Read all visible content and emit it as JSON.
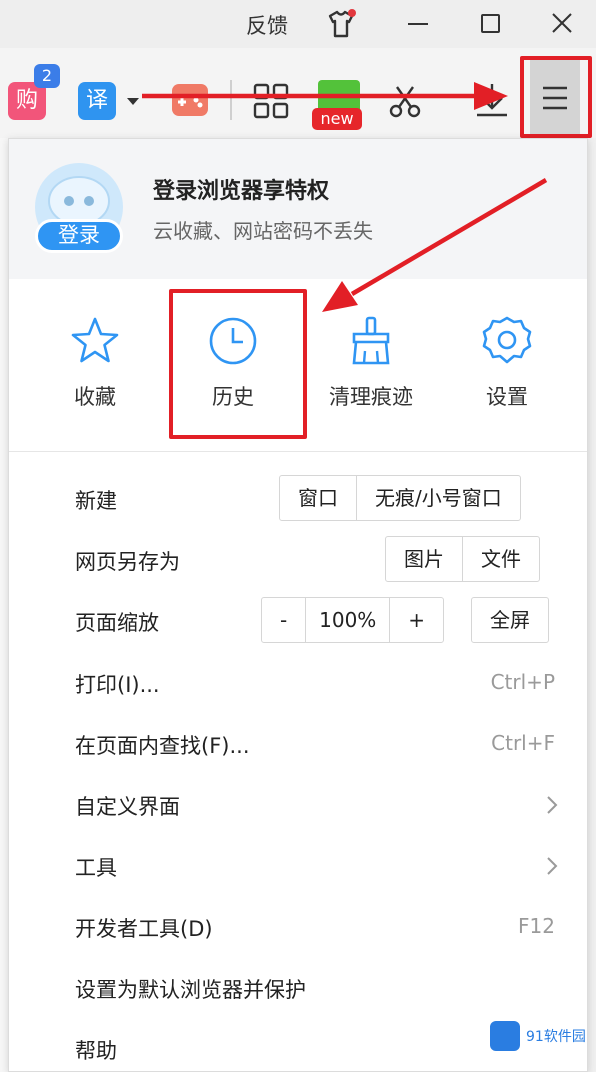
{
  "titlebar": {
    "feedback": "反馈",
    "icons": [
      "shirt-icon",
      "minimize-icon",
      "maximize-icon",
      "close-icon"
    ],
    "notify_color": "#e2373d"
  },
  "toolbar": {
    "buy_glyph": "购",
    "buy_badge": "2",
    "translate_glyph": "译",
    "new_badge": "new",
    "icons": [
      "shop-icon",
      "translate-icon",
      "dropdown-arrow-icon",
      "game-icon",
      "apps-grid-icon",
      "green-app-icon",
      "scissors-icon",
      "download-icon",
      "menu-icon"
    ]
  },
  "login": {
    "badge": "登录",
    "title": "登录浏览器享特权",
    "subtitle": "云收藏、网站密码不丢失"
  },
  "quick_actions": [
    {
      "label": "收藏",
      "icon": "star-icon"
    },
    {
      "label": "历史",
      "icon": "clock-icon"
    },
    {
      "label": "清理痕迹",
      "icon": "broom-icon"
    },
    {
      "label": "设置",
      "icon": "gear-icon"
    }
  ],
  "menu": {
    "new": {
      "label": "新建",
      "window": "窗口",
      "incognito": "无痕/小号窗口"
    },
    "save_as": {
      "label": "网页另存为",
      "image": "图片",
      "file": "文件"
    },
    "zoom": {
      "label": "页面缩放",
      "minus": "-",
      "value": "100%",
      "plus": "+",
      "fullscreen": "全屏"
    },
    "print": {
      "label": "打印(I)...",
      "shortcut": "Ctrl+P"
    },
    "find": {
      "label": "在页面内查找(F)...",
      "shortcut": "Ctrl+F"
    },
    "customize": {
      "label": "自定义界面"
    },
    "tools": {
      "label": "工具"
    },
    "devtools": {
      "label": "开发者工具(D)",
      "shortcut": "F12"
    },
    "default_browser": {
      "label": "设置为默认浏览器并保护"
    },
    "help": {
      "label": "帮助"
    }
  },
  "watermark": "91软件园",
  "colors": {
    "accent_blue": "#2f95f3",
    "highlight_red": "#e21f26",
    "new_badge": "#e6262a"
  }
}
